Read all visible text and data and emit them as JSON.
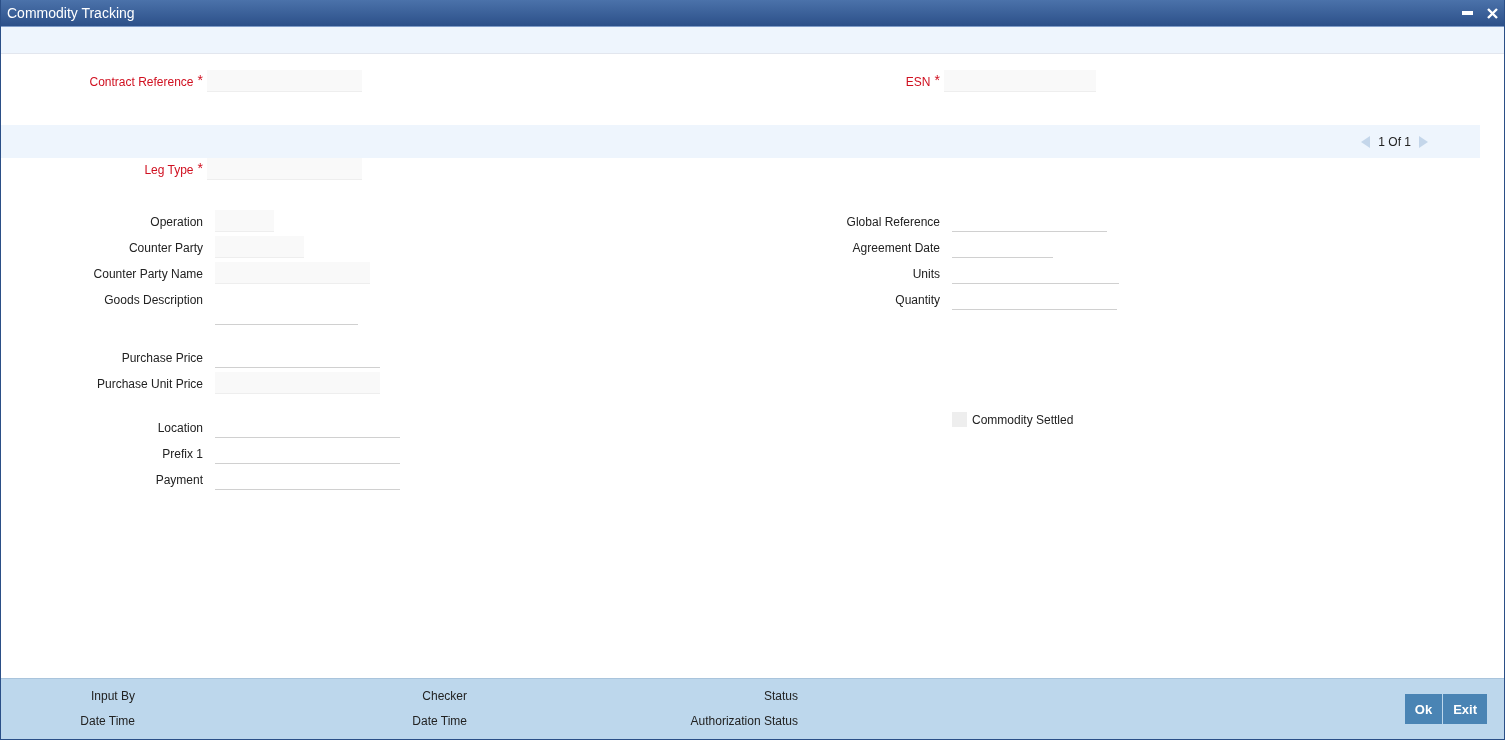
{
  "window": {
    "title": "Commodity Tracking"
  },
  "header_fields": [
    {
      "label": "Contract Reference",
      "required_mark": "*",
      "kind": "shaded"
    },
    {
      "label": "ESN",
      "required_mark": "*",
      "kind": "shaded"
    }
  ],
  "pager": {
    "current": "1",
    "separator": "Of",
    "total": "1"
  },
  "leg_type": {
    "label": "Leg Type",
    "required_mark": "*",
    "kind": "shaded"
  },
  "left_groups": [
    [
      {
        "label": "Operation",
        "kind": "shaded"
      },
      {
        "label": "Counter Party",
        "kind": "shaded"
      },
      {
        "label": "Counter Party Name",
        "kind": "shaded"
      },
      {
        "label": "Goods Description",
        "kind": "textarea"
      }
    ],
    [
      {
        "label": "Purchase Price",
        "kind": "underline"
      },
      {
        "label": "Purchase Unit Price",
        "kind": "shaded"
      }
    ],
    [
      {
        "label": "Location",
        "kind": "underline"
      },
      {
        "label": "Prefix 1",
        "kind": "underline"
      },
      {
        "label": "Payment",
        "kind": "underline"
      }
    ]
  ],
  "right_fields": [
    {
      "label": "Global Reference",
      "kind": "underline"
    },
    {
      "label": "Agreement Date",
      "kind": "underline"
    },
    {
      "label": "Units",
      "kind": "underline"
    },
    {
      "label": "Quantity",
      "kind": "underline"
    }
  ],
  "commodity_settled": {
    "label": "Commodity Settled",
    "checked": false
  },
  "audit": [
    {
      "label": "Input By"
    },
    {
      "label": "Checker"
    },
    {
      "label": "Status"
    },
    {
      "label": "Date Time"
    },
    {
      "label": "Date Time"
    },
    {
      "label": "Authorization Status"
    }
  ],
  "buttons": [
    "Ok",
    "Exit"
  ]
}
